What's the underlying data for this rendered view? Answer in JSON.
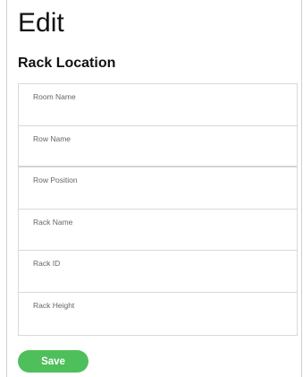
{
  "page": {
    "title": "Edit"
  },
  "section": {
    "title": "Rack Location"
  },
  "fields": [
    {
      "label": "Room Name",
      "value": ""
    },
    {
      "label": "Row Name",
      "value": ""
    },
    {
      "label": "Row Position",
      "value": ""
    },
    {
      "label": "Rack Name",
      "value": ""
    },
    {
      "label": "Rack ID",
      "value": ""
    },
    {
      "label": "Rack Height",
      "value": ""
    }
  ],
  "actions": {
    "save_label": "Save"
  },
  "colors": {
    "save_button": "#4fbf5b",
    "border": "#d9d9d9",
    "label_text": "#666666"
  }
}
